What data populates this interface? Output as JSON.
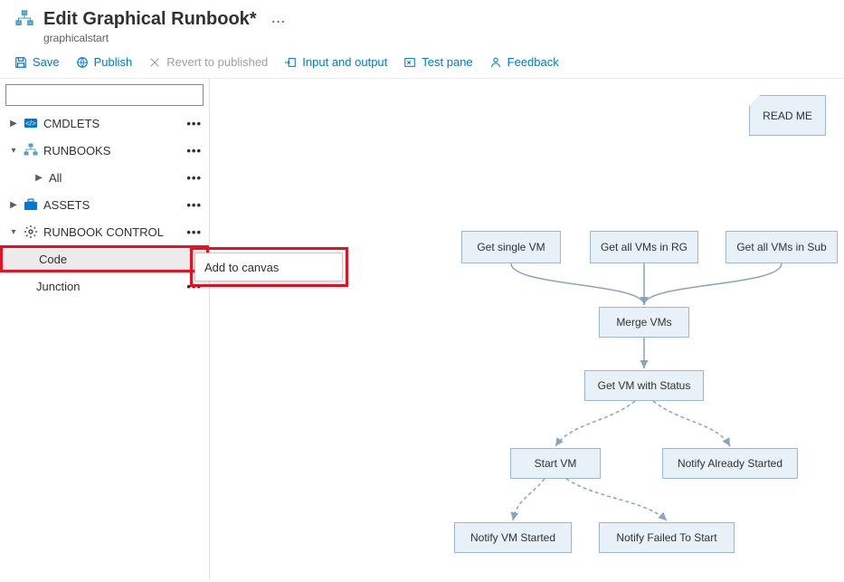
{
  "header": {
    "title": "Edit Graphical Runbook*",
    "subtitle": "graphicalstart"
  },
  "toolbar": {
    "save": "Save",
    "publish": "Publish",
    "revert": "Revert to published",
    "input_output": "Input and output",
    "test_pane": "Test pane",
    "feedback": "Feedback"
  },
  "search": {
    "placeholder": ""
  },
  "tree": {
    "cmdlets": "CMDLETS",
    "runbooks": "RUNBOOKS",
    "all": "All",
    "assets": "ASSETS",
    "runbook_control": "RUNBOOK CONTROL",
    "code": "Code",
    "junction": "Junction"
  },
  "context_menu": {
    "add_to_canvas": "Add to canvas"
  },
  "canvas": {
    "readme": "READ ME",
    "get_single_vm": "Get single VM",
    "get_all_rg": "Get all VMs in RG",
    "get_all_sub": "Get all VMs in Sub",
    "merge_vms": "Merge VMs",
    "get_vm_status": "Get VM with Status",
    "start_vm": "Start VM",
    "notify_already": "Notify Already Started",
    "notify_started": "Notify VM Started",
    "notify_failed": "Notify Failed To Start"
  }
}
